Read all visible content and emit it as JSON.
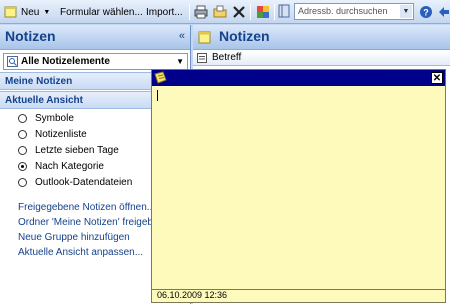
{
  "toolbar": {
    "new_label": "Neu",
    "form_label": "Formular wählen...",
    "import_label": "Import...",
    "address_search_placeholder": "Adressb. durchsuchen"
  },
  "left_pane": {
    "title": "Notizen",
    "filter_value": "Alle Notizelemente",
    "section_my_notes": "Meine Notizen",
    "section_current_view": "Aktuelle Ansicht",
    "views": [
      {
        "label": "Symbole",
        "selected": false
      },
      {
        "label": "Notizenliste",
        "selected": false
      },
      {
        "label": "Letzte sieben Tage",
        "selected": false
      },
      {
        "label": "Nach Kategorie",
        "selected": true
      },
      {
        "label": "Outlook-Datendateien",
        "selected": false
      }
    ],
    "links": [
      "Freigegebene Notizen öffnen...",
      "Ordner 'Meine Notizen' freigeben",
      "Neue Gruppe hinzufügen",
      "Aktuelle Ansicht anpassen..."
    ]
  },
  "right_pane": {
    "title": "Notizen",
    "column_subject": "Betreff"
  },
  "note": {
    "timestamp": "06.10.2009 12:36",
    "close_symbol": "✕"
  },
  "colors": {
    "note_background": "#fdfabc",
    "note_titlebar": "#00008b",
    "header_text": "#15428b"
  }
}
